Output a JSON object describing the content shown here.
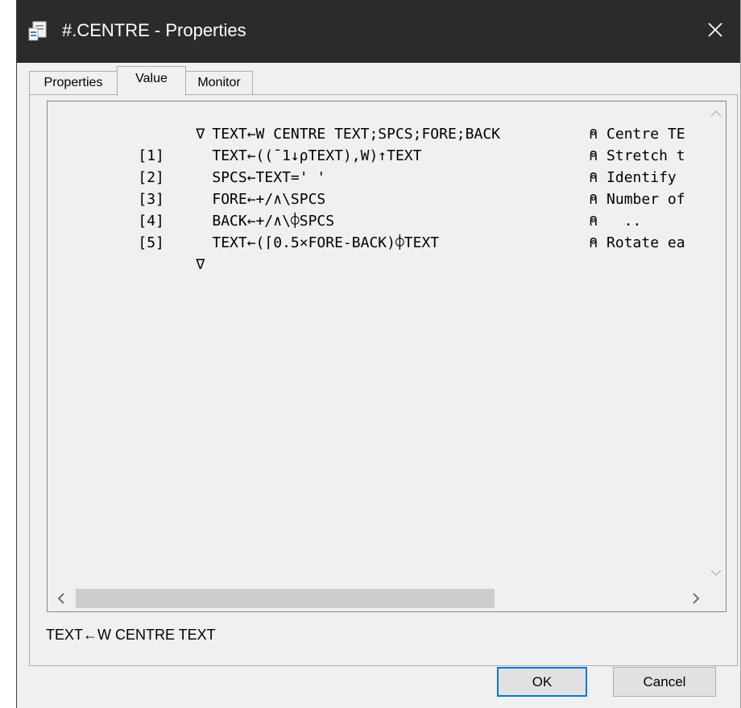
{
  "window": {
    "title": "#.CENTRE - Properties",
    "icons": {
      "app": "property-sheet-icon",
      "close": "close-icon"
    }
  },
  "tabs": [
    {
      "label": "Properties",
      "active": false
    },
    {
      "label": "Value",
      "active": true
    },
    {
      "label": "Monitor",
      "active": false
    }
  ],
  "editor": {
    "lines": [
      {
        "num": "",
        "del": "∇",
        "code": "TEXT←W CENTRE TEXT;SPCS;FORE;BACK",
        "comment": "⍝ Centre TE"
      },
      {
        "num": "[1]",
        "del": "",
        "code": "TEXT←((¯1↓⍴TEXT),W)↑TEXT",
        "comment": "⍝ Stretch t"
      },
      {
        "num": "[2]",
        "del": "",
        "code": "SPCS←TEXT=' '",
        "comment": "⍝ Identify"
      },
      {
        "num": "[3]",
        "del": "",
        "code": "FORE←+/∧\\SPCS",
        "comment": "⍝ Number of"
      },
      {
        "num": "[4]",
        "del": "",
        "code": "BACK←+/∧\\⌽SPCS",
        "comment": "⍝   .."
      },
      {
        "num": "[5]",
        "del": "",
        "code": "TEXT←(⌈0.5×FORE-BACK)⌽TEXT",
        "comment": "⍝ Rotate ea"
      },
      {
        "num": "",
        "del": "∇",
        "code": "",
        "comment": ""
      }
    ],
    "icons": {
      "scroll_up": "chevron-up-icon",
      "scroll_down": "chevron-down-icon",
      "scroll_left": "chevron-left-icon",
      "scroll_right": "chevron-right-icon"
    }
  },
  "status_text": "TEXT←W CENTRE TEXT",
  "buttons": {
    "ok": "OK",
    "cancel": "Cancel"
  },
  "colors": {
    "titlebar": "#2b2b2b",
    "focus_border": "#0078d7",
    "dialog_bg": "#f0f0f0"
  }
}
